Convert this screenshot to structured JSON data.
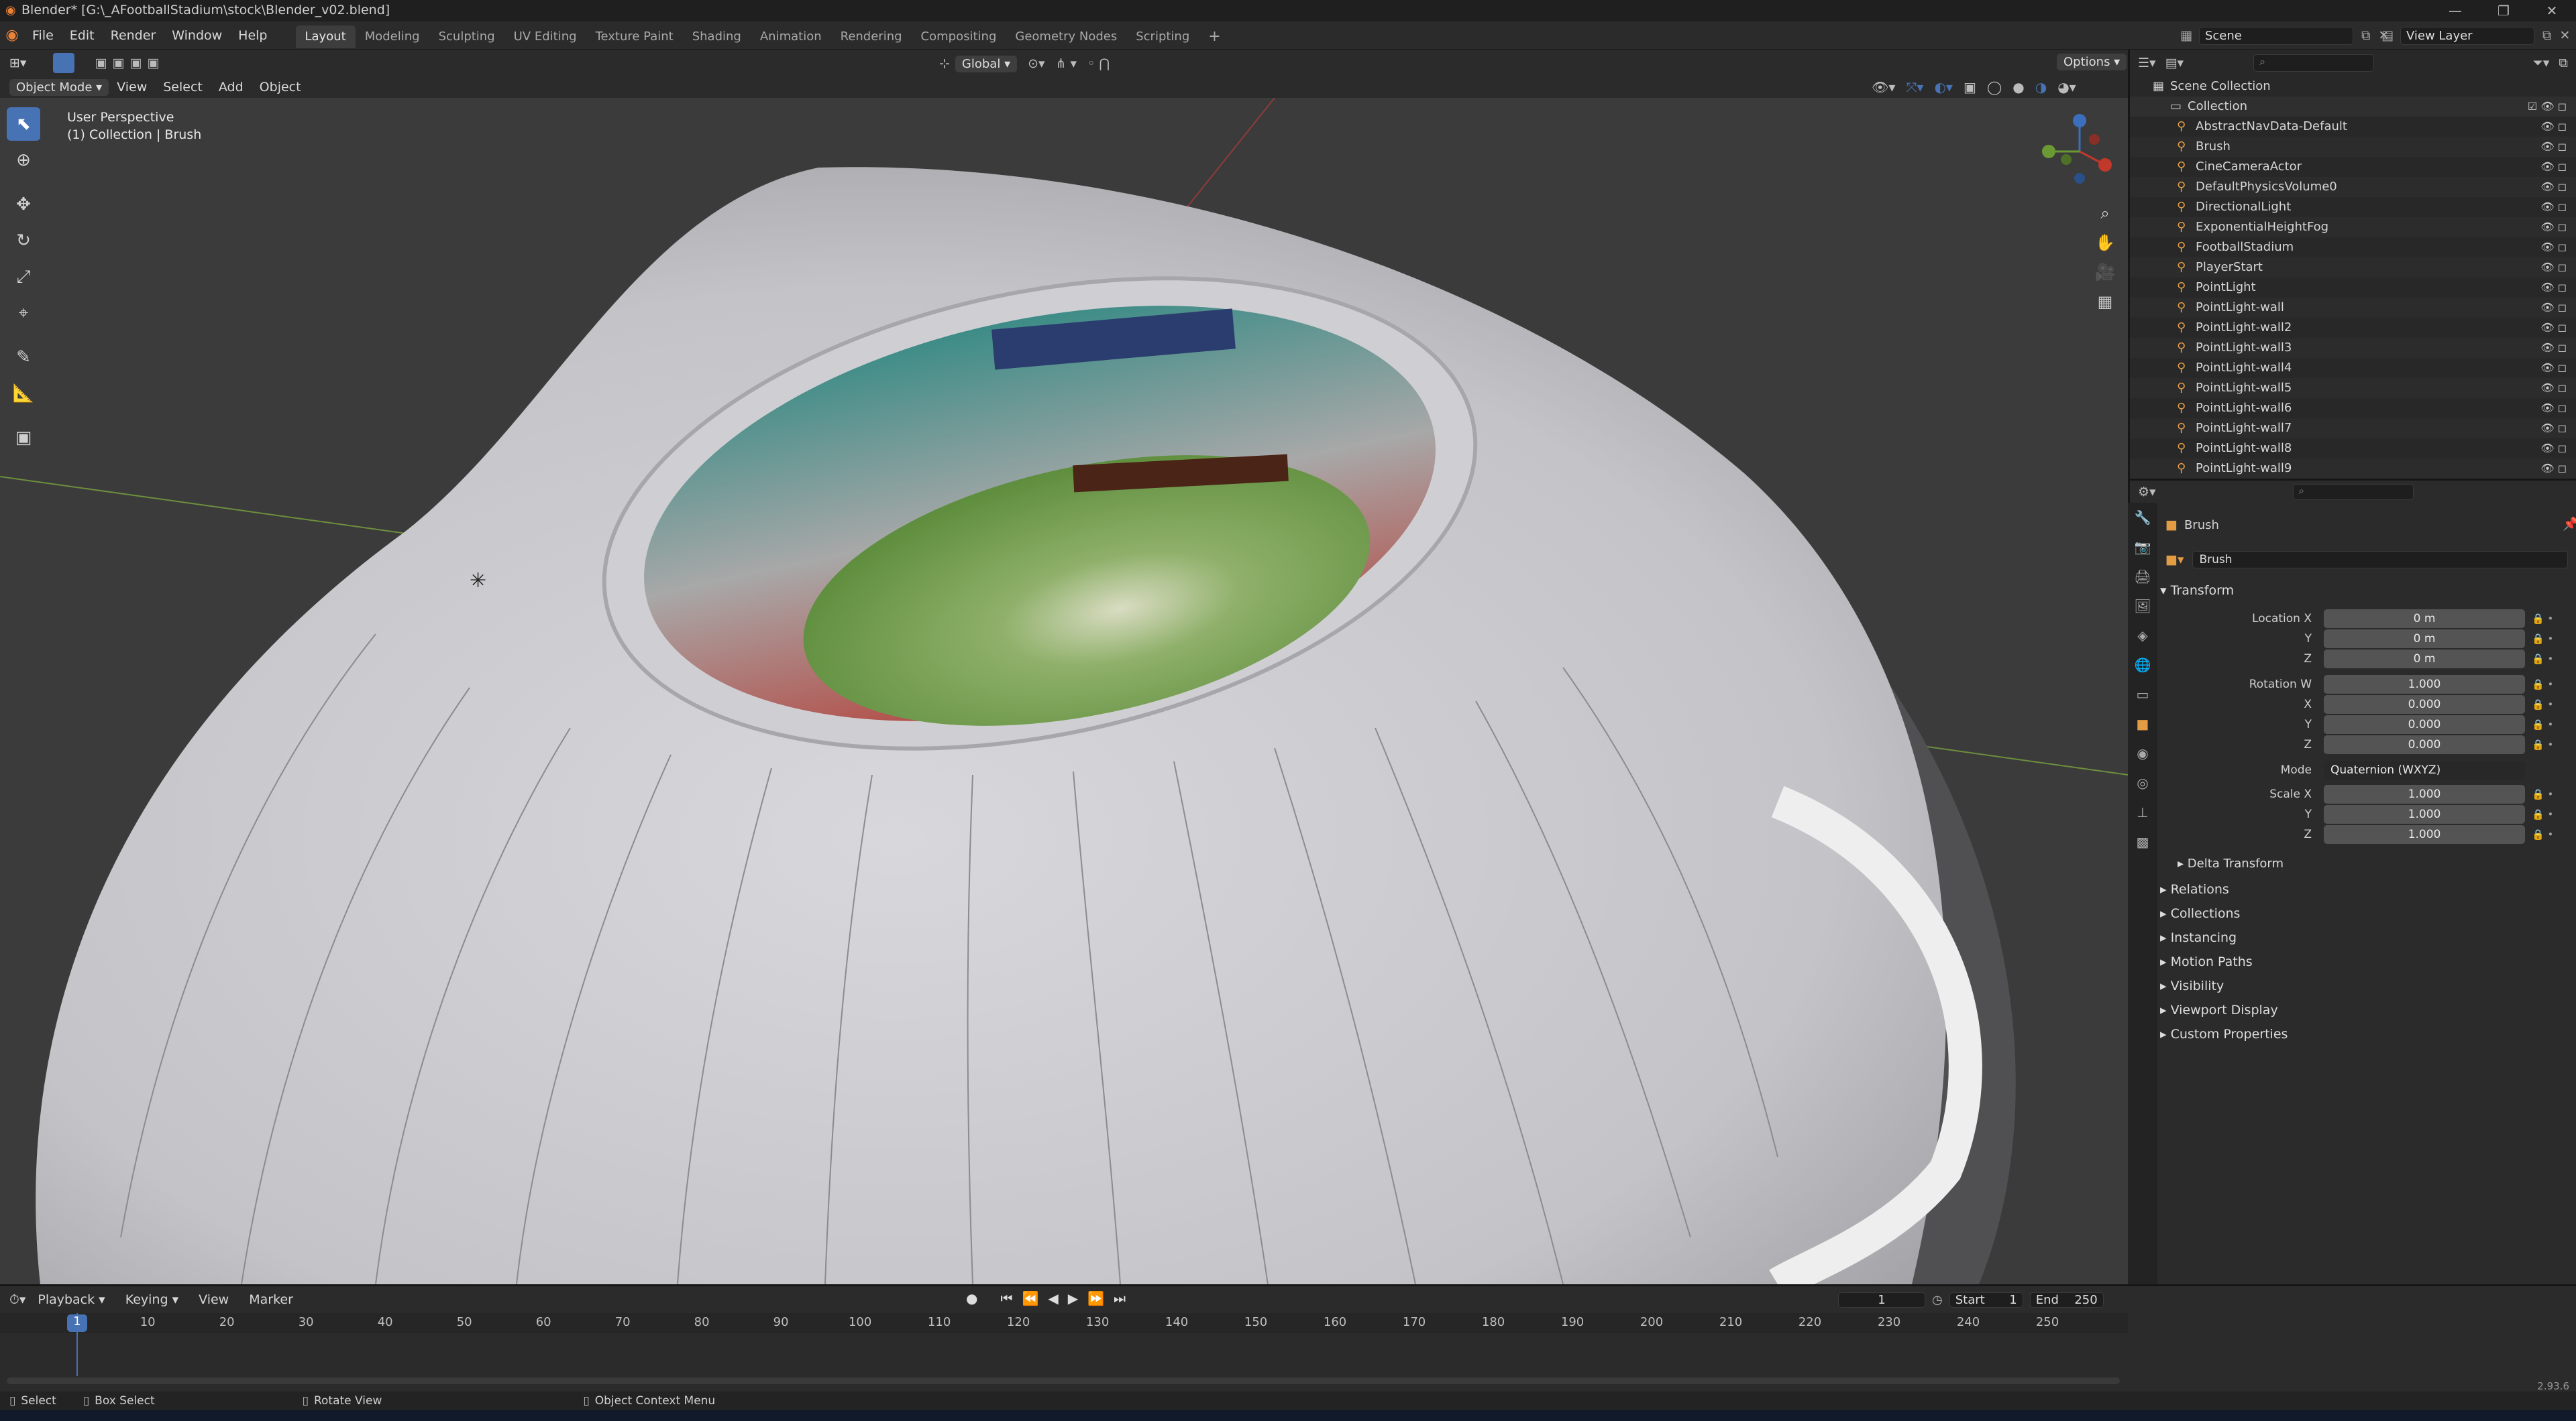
{
  "window": {
    "title": "Blender* [G:\\_AFootballStadium\\stock\\Blender_v02.blend]",
    "controls": [
      "—",
      "❐",
      "✕"
    ]
  },
  "menus": [
    "File",
    "Edit",
    "Render",
    "Window",
    "Help"
  ],
  "workspaces": [
    "Layout",
    "Modeling",
    "Sculpting",
    "UV Editing",
    "Texture Paint",
    "Shading",
    "Animation",
    "Rendering",
    "Compositing",
    "Geometry Nodes",
    "Scripting"
  ],
  "active_workspace": "Layout",
  "scene": {
    "label": "Scene",
    "view_layer": "View Layer"
  },
  "viewport_header": {
    "mode": "Object Mode",
    "menus": [
      "View",
      "Select",
      "Add",
      "Object"
    ],
    "orientation": "Global",
    "options": "Options"
  },
  "viewport": {
    "perspective": "User Perspective",
    "collection_info": "(1) Collection | Brush"
  },
  "outliner": {
    "root": "Scene Collection",
    "collection": "Collection",
    "items": [
      "AbstractNavData-Default",
      "Brush",
      "CineCameraActor",
      "DefaultPhysicsVolume0",
      "DirectionalLight",
      "ExponentialHeightFog",
      "FootballStadium",
      "PlayerStart",
      "PointLight",
      "PointLight-wall",
      "PointLight-wall2",
      "PointLight-wall3",
      "PointLight-wall4",
      "PointLight-wall5",
      "PointLight-wall6",
      "PointLight-wall7",
      "PointLight-wall8",
      "PointLight-wall9"
    ]
  },
  "properties": {
    "object_name": "Brush",
    "data_name": "Brush",
    "transform_label": "Transform",
    "location_label": "Location X",
    "location": [
      "0 m",
      "0 m",
      "0 m"
    ],
    "rotation_label": "Rotation W",
    "rotation": [
      "1.000",
      "0.000",
      "0.000",
      "0.000"
    ],
    "mode_label": "Mode",
    "mode_value": "Quaternion (WXYZ)",
    "scale_label": "Scale X",
    "scale": [
      "1.000",
      "1.000",
      "1.000"
    ],
    "axis_labels": [
      "X",
      "Y",
      "Z"
    ],
    "delta": "Delta Transform",
    "panels": [
      "Relations",
      "Collections",
      "Instancing",
      "Motion Paths",
      "Visibility",
      "Viewport Display",
      "Custom Properties"
    ]
  },
  "timeline": {
    "menus": [
      "Playback",
      "Keying",
      "View",
      "Marker"
    ],
    "current_frame": "1",
    "start_label": "Start",
    "start": "1",
    "end_label": "End",
    "end": "250",
    "ticks": [
      "10",
      "20",
      "30",
      "40",
      "50",
      "60",
      "70",
      "80",
      "90",
      "100",
      "110",
      "120",
      "130",
      "140",
      "150",
      "160",
      "170",
      "180",
      "190",
      "200",
      "210",
      "220",
      "230",
      "240",
      "250"
    ]
  },
  "statusbar": {
    "select": "Select",
    "box_select": "Box Select",
    "rotate_view": "Rotate View",
    "context_menu": "Object Context Menu",
    "version": "2.93.6"
  },
  "colors": {
    "accent": "#4772b3",
    "object_orange": "#e39c43",
    "field_pitch": "#6fa04a"
  }
}
